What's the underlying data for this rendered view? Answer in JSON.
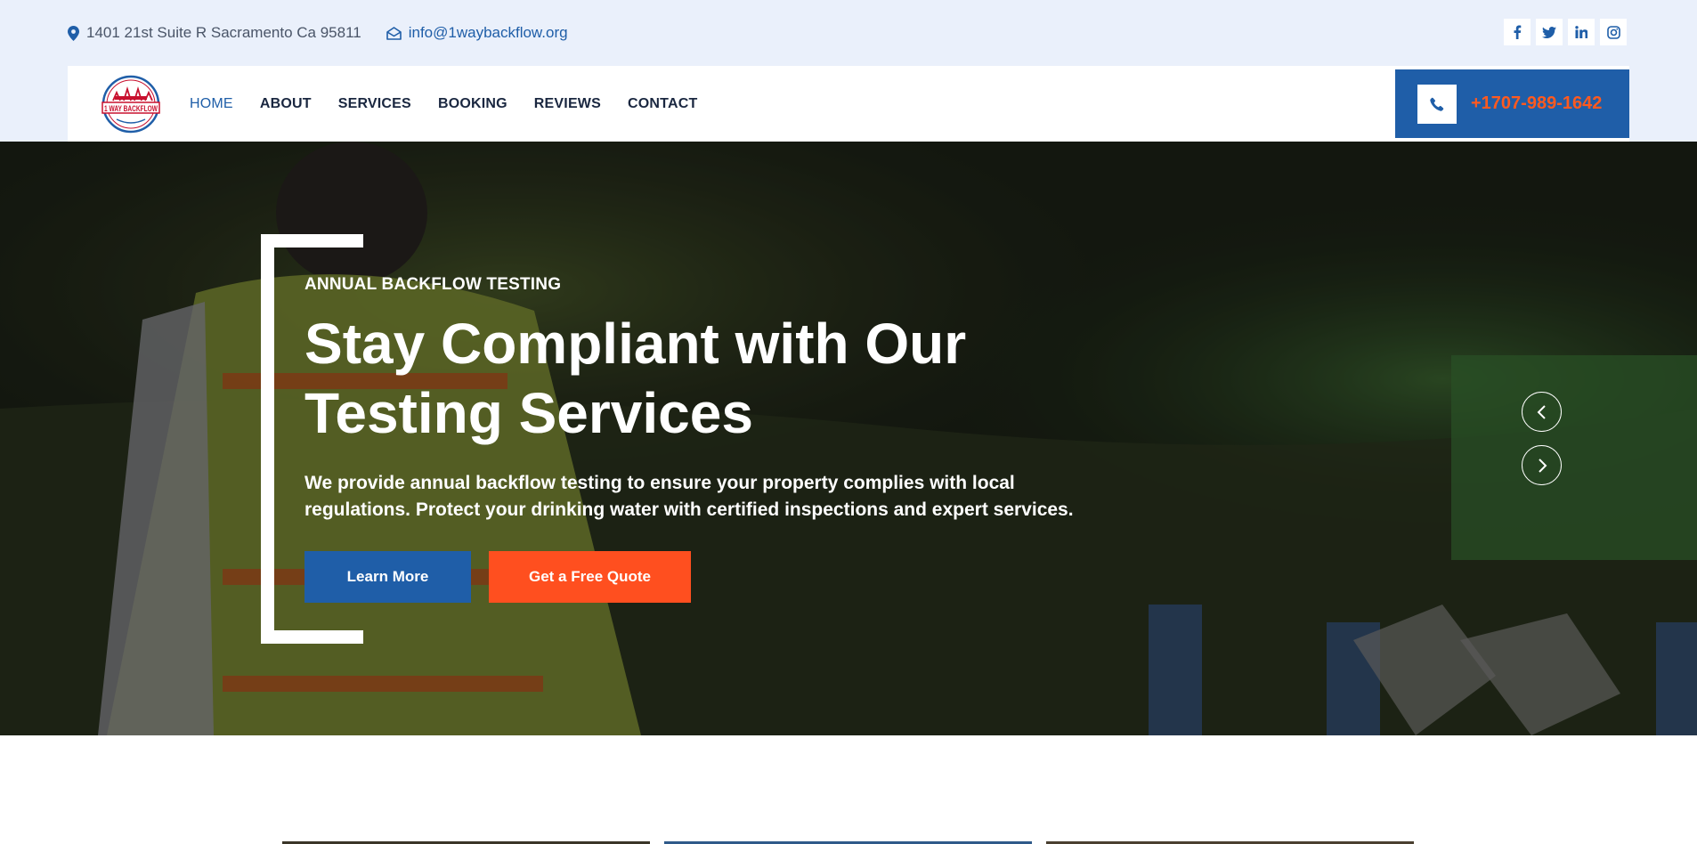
{
  "topbar": {
    "address": "1401 21st Suite R Sacramento Ca 95811",
    "email": "info@1waybackflow.org",
    "socials": [
      "facebook-icon",
      "twitter-icon",
      "linkedin-icon",
      "instagram-icon"
    ]
  },
  "logo": {
    "text": "1 WAY BACKFLOW"
  },
  "nav": {
    "items": [
      {
        "label": "HOME",
        "active": true
      },
      {
        "label": "ABOUT"
      },
      {
        "label": "SERVICES"
      },
      {
        "label": "BOOKING"
      },
      {
        "label": "REVIEWS"
      },
      {
        "label": "CONTACT"
      }
    ]
  },
  "phone": {
    "number": "+1707-989-1642"
  },
  "hero": {
    "eyebrow": "ANNUAL BACKFLOW TESTING",
    "headline": "Stay Compliant with Our Testing Services",
    "description": "We provide annual backflow testing to ensure your property complies with local regulations. Protect your drinking water with certified inspections and expert services.",
    "primary_button": "Learn More",
    "secondary_button": "Get a Free Quote"
  },
  "colors": {
    "brand_blue": "#1f5ea8",
    "accent_orange": "#ff4f1f",
    "topbar_bg": "#eaf0fb",
    "nav_text": "#1a2740"
  }
}
